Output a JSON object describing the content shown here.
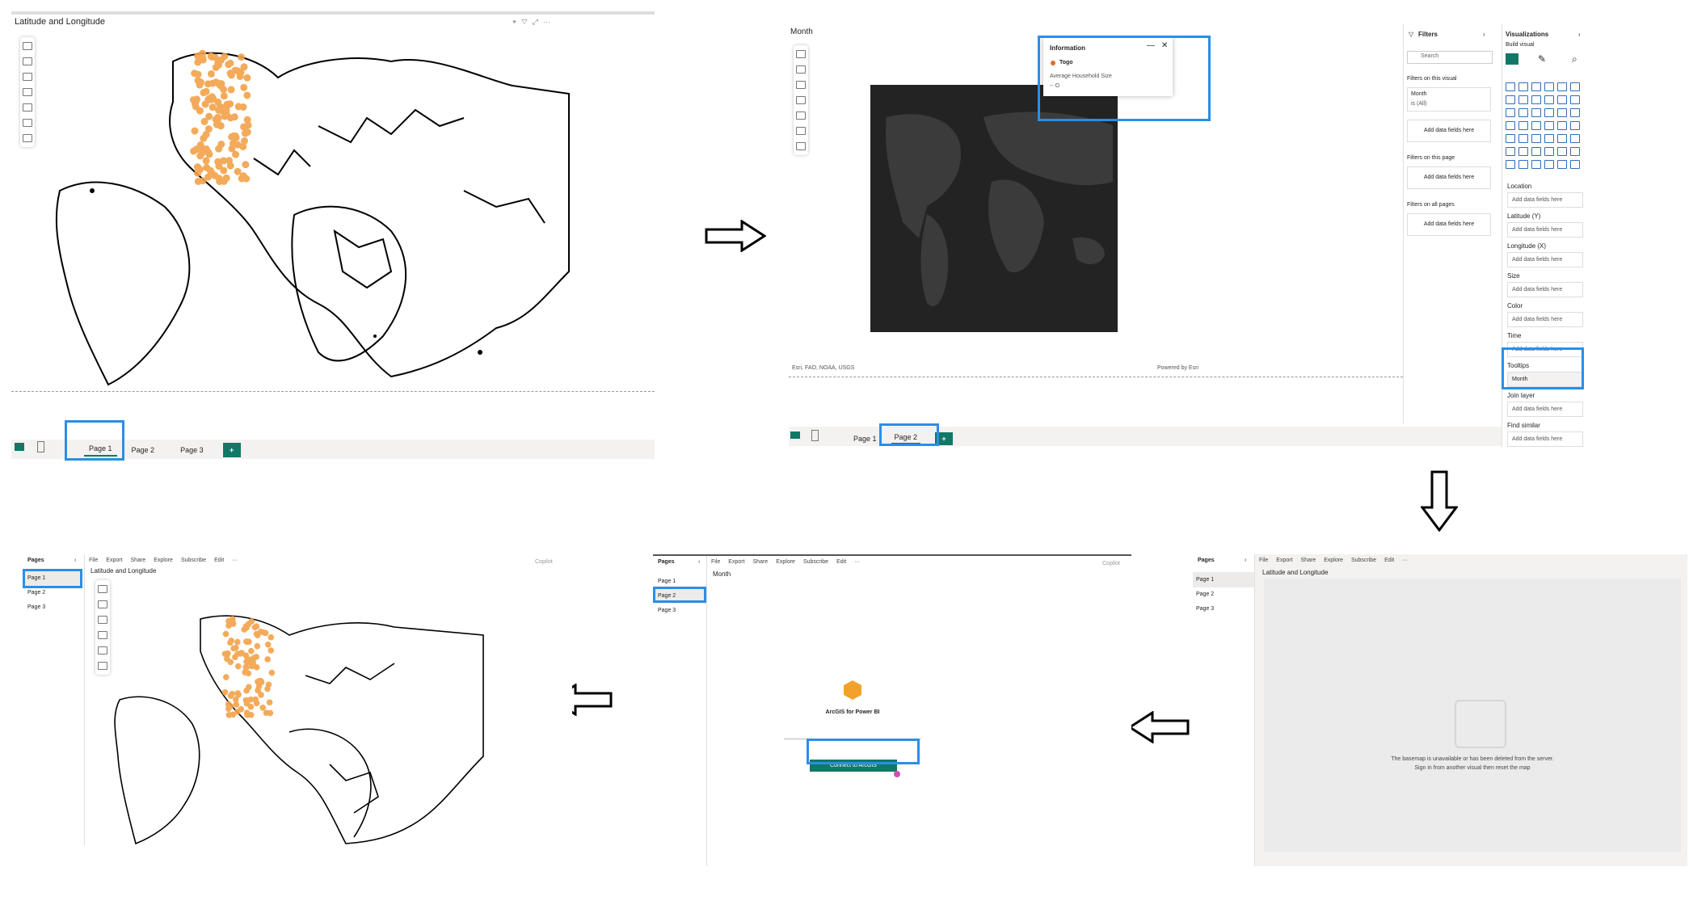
{
  "p1": {
    "title": "Latitude and Longitude",
    "tabs": [
      "Page 1",
      "Page 2",
      "Page 3"
    ],
    "add": "+"
  },
  "p2": {
    "visual_title": "Month",
    "info_popup": {
      "title": "Information",
      "country": "Togo",
      "field": "Average Household Size",
      "value": "-- O"
    },
    "attribution_left": "Esri, FAO, NOAA, USGS",
    "attribution_right": "Powered by Esri",
    "tabs": [
      "Page 1",
      "Page 2"
    ],
    "add": "+",
    "filters": {
      "title": "Filters",
      "search_placeholder": "Search",
      "on_visual": "Filters on this visual",
      "month_label": "Month",
      "month_value": "is (All)",
      "add_fields": "Add data fields here",
      "on_page": "Filters on this page",
      "on_all": "Filters on all pages"
    },
    "viz": {
      "title": "Visualizations",
      "build": "Build visual",
      "wells": [
        {
          "label": "Location",
          "value": "Add data fields here"
        },
        {
          "label": "Latitude (Y)",
          "value": "Add data fields here"
        },
        {
          "label": "Longitude (X)",
          "value": "Add data fields here"
        },
        {
          "label": "Size",
          "value": "Add data fields here"
        },
        {
          "label": "Color",
          "value": "Add data fields here"
        },
        {
          "label": "Time",
          "value": "Add data fields here"
        },
        {
          "label": "Tooltips",
          "value": "Month"
        },
        {
          "label": "Join layer",
          "value": "Add data fields here"
        },
        {
          "label": "Find similar",
          "value": "Add data fields here"
        }
      ]
    }
  },
  "p3": {
    "pages_title": "Pages",
    "pages": [
      "Page 1",
      "Page 2",
      "Page 3"
    ],
    "menu": [
      "File",
      "Export",
      "Share",
      "Explore",
      "Subscribe",
      "Edit",
      "···"
    ],
    "copilot": "Copilot",
    "title": "Latitude and Longitude",
    "message_line1": "The basemap is unavailable or has been deleted from the server.",
    "message_line2": "Sign in from another visual then reset the map"
  },
  "p4": {
    "pages_title": "Pages",
    "pages": [
      "Page 1",
      "Page 2",
      "Page 3"
    ],
    "menu": [
      "File",
      "Export",
      "Share",
      "Explore",
      "Subscribe",
      "Edit",
      "···"
    ],
    "copilot": "Copilot",
    "title": "Month",
    "product": "ArcGIS for Power BI",
    "connect": "Connect to ArcGIS"
  },
  "p5": {
    "pages_title": "Pages",
    "pages": [
      "Page 1",
      "Page 2",
      "Page 3"
    ],
    "menu": [
      "File",
      "Export",
      "Share",
      "Explore",
      "Subscribe",
      "Edit",
      "···"
    ],
    "copilot": "Copilot",
    "title": "Latitude and Longitude"
  },
  "colors": {
    "accent": "#117865",
    "highlight": "#2b8ee8",
    "dots": "#f2a24a"
  }
}
